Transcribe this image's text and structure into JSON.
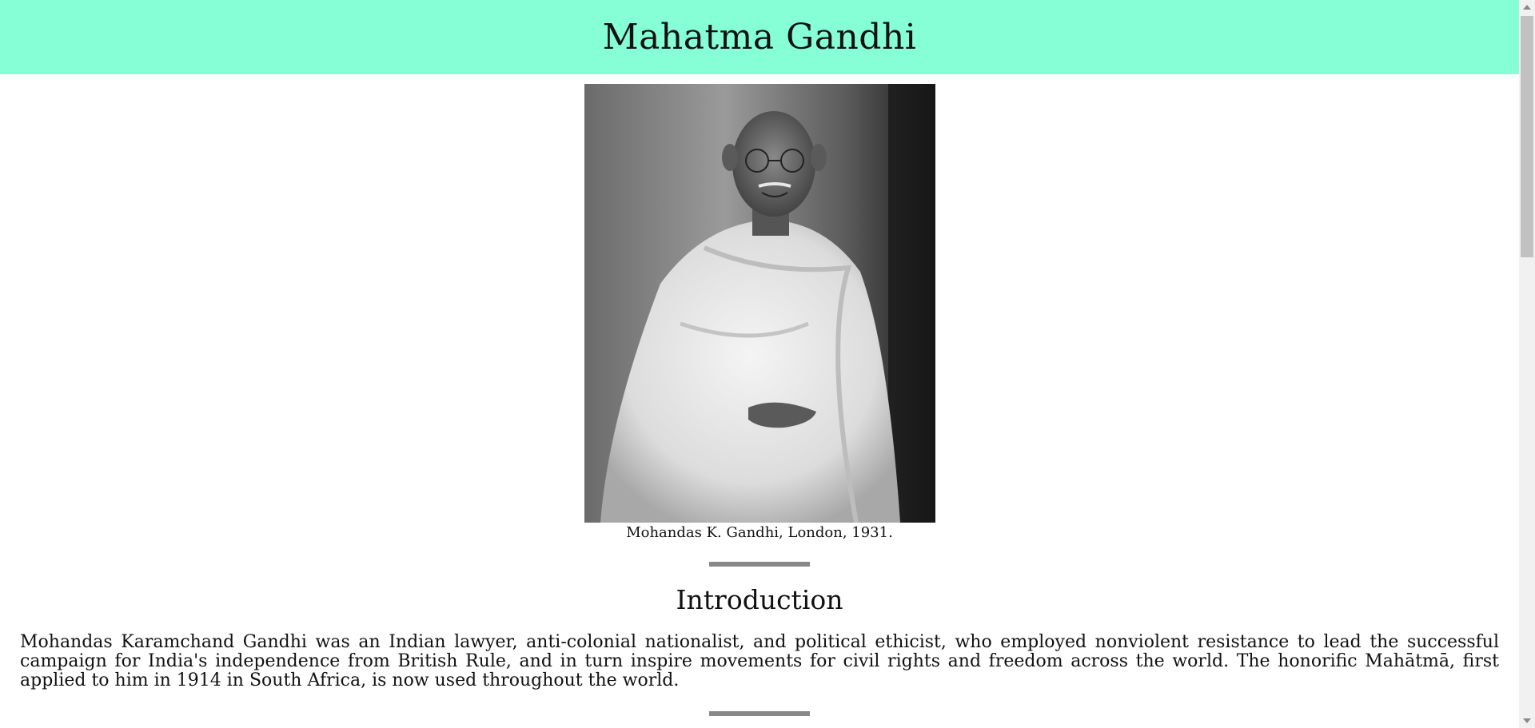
{
  "header": {
    "title": "Mahatma Gandhi"
  },
  "figure": {
    "image_icon": "gandhi-portrait-photo",
    "caption": "Mohandas K. Gandhi, London, 1931."
  },
  "introduction": {
    "heading": "Introduction",
    "text": "Mohandas Karamchand Gandhi was an Indian lawyer, anti-colonial nationalist, and political ethicist, who employed nonviolent resistance to lead the successful campaign for India's independence from British Rule, and in turn inspire movements for civil rights and freedom across the world. The honorific Mahātmā, first applied to him in 1914 in South Africa, is now used throughout the world."
  },
  "colors": {
    "header_bg": "#86ffd6",
    "divider": "#888888"
  }
}
